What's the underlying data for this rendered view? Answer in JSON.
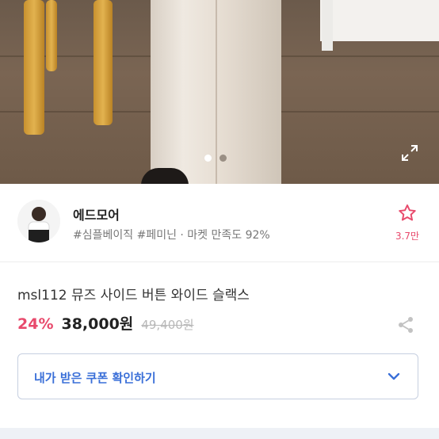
{
  "gallery": {
    "dots": [
      {
        "active": true,
        "color": "#ffffff"
      },
      {
        "active": false,
        "color": "#9a8f84"
      }
    ],
    "expand_icon": "expand-icon"
  },
  "seller": {
    "name": "에드모어",
    "tags": "#심플베이직 #페미닌 · 마켓 만족도 92%",
    "favorite_icon": "star-icon",
    "favorite_count": "3.7만"
  },
  "product": {
    "title": "msl112 뮤즈 사이드 버튼 와이드 슬랙스",
    "discount": "24%",
    "price": "38,000원",
    "original_price": "49,400원",
    "share_icon": "share-icon"
  },
  "coupon": {
    "label": "내가 받은 쿠폰 확인하기",
    "chevron_icon": "chevron-down-icon"
  },
  "colors": {
    "accent_pink": "#e84a6c",
    "accent_blue": "#3a6fd8"
  }
}
